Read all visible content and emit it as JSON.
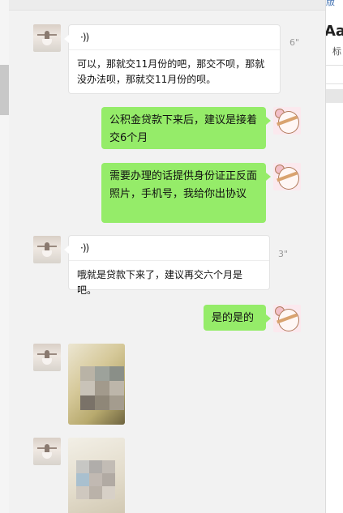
{
  "messages": [
    {
      "side": "in",
      "type": "voice",
      "duration": "6\"",
      "transcript": "可以，那就交11月份的吧，那交不呗，那就没办法呗，那就交11月份的呗。"
    },
    {
      "side": "out",
      "type": "text",
      "text": "公积金贷款下来后，建议是接着交6个月"
    },
    {
      "side": "out",
      "type": "text",
      "text": "需要办理的话提供身份证正反面照片，手机号，我给你出协议"
    },
    {
      "side": "in",
      "type": "voice",
      "duration": "3\"",
      "transcript": "哦就是贷款下来了，建议再交六个月是吧。"
    },
    {
      "side": "out",
      "type": "text",
      "text": "是的是的"
    },
    {
      "side": "in",
      "type": "image"
    },
    {
      "side": "in",
      "type": "image"
    }
  ],
  "icons": {
    "voice": "·))"
  },
  "right_panel": {
    "top_link": "版",
    "font_sample": "Aal",
    "label": "标"
  },
  "colors": {
    "outgoing_bubble": "#95ec69",
    "incoming_bubble": "#ffffff",
    "chat_background": "#f2f2f2"
  }
}
